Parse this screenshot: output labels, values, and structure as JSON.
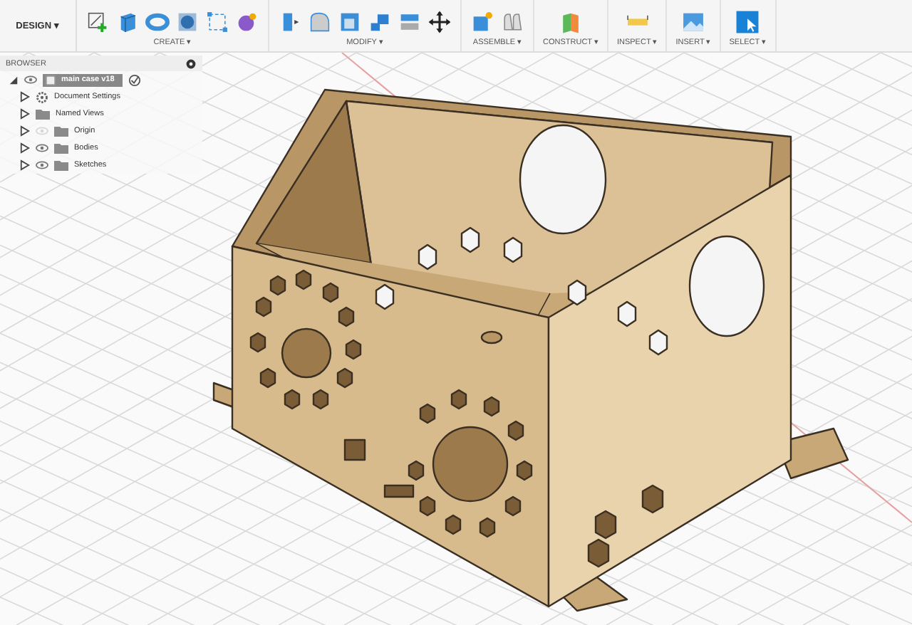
{
  "workspace": {
    "label": "DESIGN",
    "caret": "▾"
  },
  "toolbar_groups": [
    {
      "label": "CREATE ▾"
    },
    {
      "label": "MODIFY ▾"
    },
    {
      "label": "ASSEMBLE ▾"
    },
    {
      "label": "CONSTRUCT ▾"
    },
    {
      "label": "INSPECT ▾"
    },
    {
      "label": "INSERT ▾"
    },
    {
      "label": "SELECT ▾"
    }
  ],
  "browser": {
    "title": "BROWSER",
    "root": {
      "label": "main case v18",
      "selected": true,
      "expanded": true
    },
    "items": [
      {
        "label": "Document Settings",
        "kind": "settings"
      },
      {
        "label": "Named Views",
        "kind": "folder"
      },
      {
        "label": "Origin",
        "kind": "folder",
        "visible": false
      },
      {
        "label": "Bodies",
        "kind": "folder",
        "visible": true
      },
      {
        "label": "Sketches",
        "kind": "folder",
        "visible": true
      }
    ]
  }
}
